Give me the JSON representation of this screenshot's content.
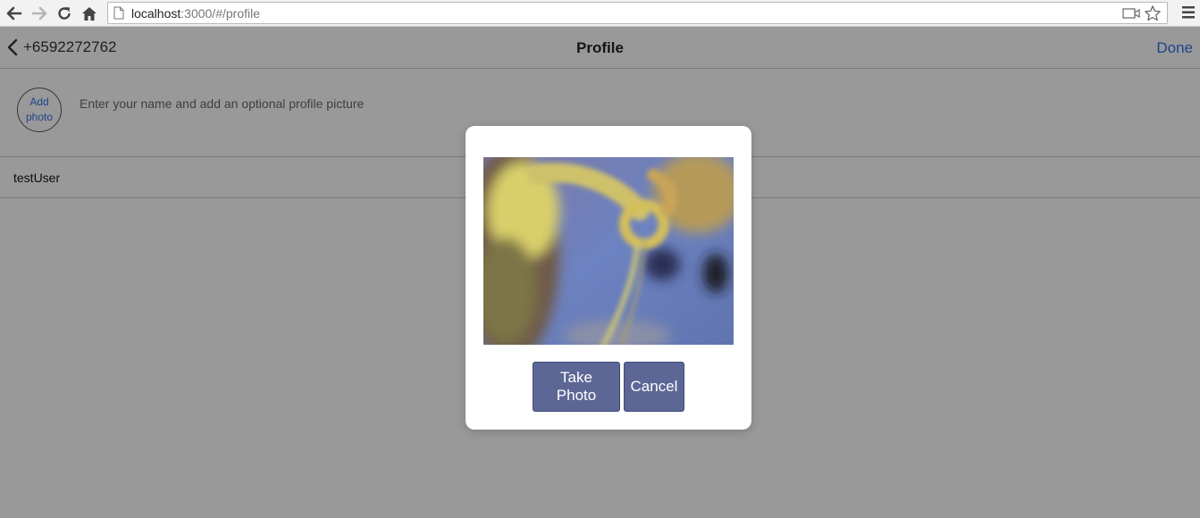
{
  "browser": {
    "url_host": "localhost",
    "url_rest": ":3000/#/profile"
  },
  "header": {
    "back_label": "+6592272762",
    "title": "Profile",
    "done_label": "Done"
  },
  "profile": {
    "add_photo_line1": "Add",
    "add_photo_line2": "photo",
    "hint": "Enter your name and add an optional profile picture",
    "name_value": "testUser"
  },
  "modal": {
    "take_photo_label": "Take Photo",
    "cancel_label": "Cancel"
  },
  "colors": {
    "accent": "#2f6fe0",
    "button": "#5d6796"
  }
}
